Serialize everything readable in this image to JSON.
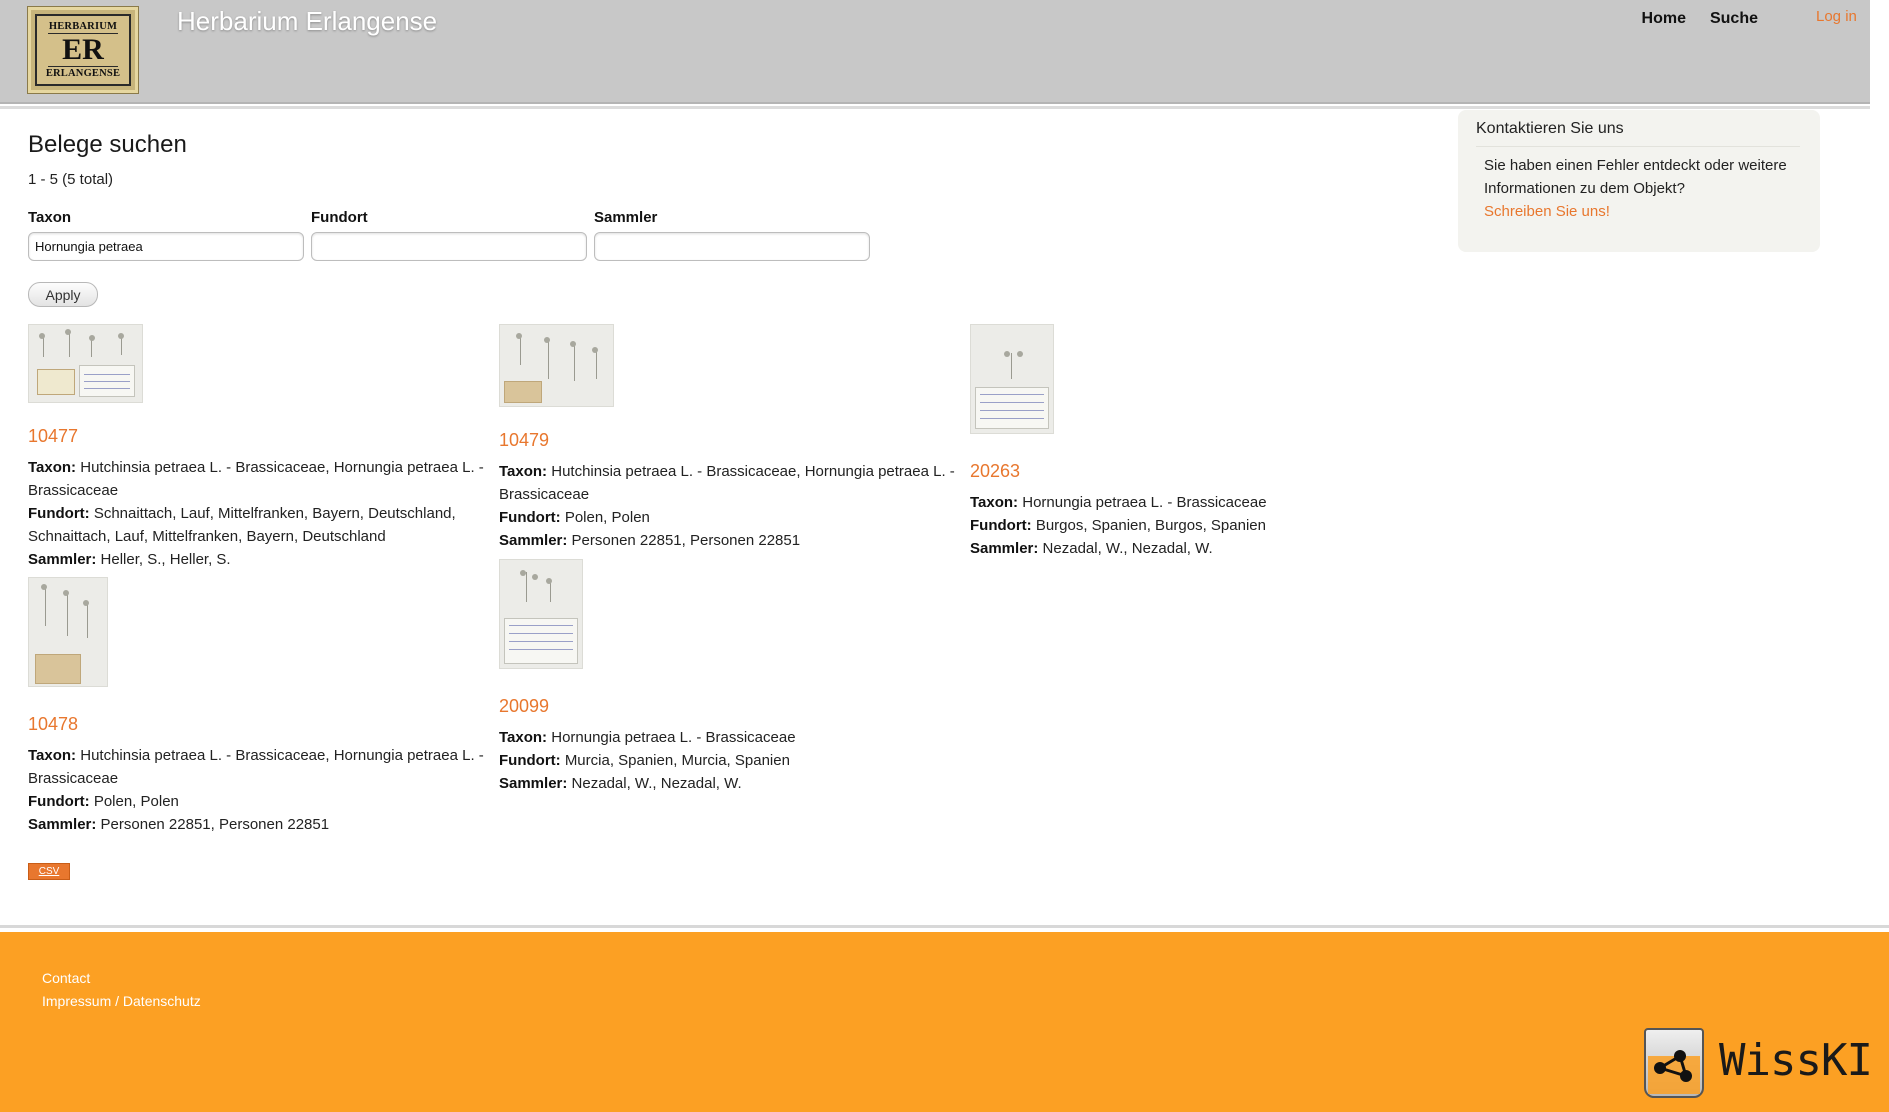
{
  "header": {
    "logo": {
      "line1": "HERBARIUM",
      "line2": "ER",
      "line3": "ERLANGENSE"
    },
    "site_title": "Herbarium Erlangense",
    "nav": [
      {
        "label": "Home"
      },
      {
        "label": "Suche"
      }
    ],
    "login_label": "Log in"
  },
  "search": {
    "title": "Belege suchen",
    "result_count": "1 - 5 (5 total)",
    "filters": {
      "taxon": {
        "label": "Taxon",
        "value": "Hornungia petraea"
      },
      "fundort": {
        "label": "Fundort",
        "value": ""
      },
      "sammler": {
        "label": "Sammler",
        "value": ""
      }
    },
    "apply_label": "Apply",
    "field_labels": {
      "taxon": "Taxon:",
      "fundort": "Fundort:",
      "sammler": "Sammler:"
    }
  },
  "results": [
    {
      "id": "10477",
      "taxon": "Hutchinsia petraea L. - Brassicaceae, Hornungia petraea L. - Brassicaceae",
      "fundort": "Schnaittach, Lauf, Mittelfranken, Bayern, Deutschland, Schnaittach, Lauf, Mittelfranken, Bayern, Deutschland",
      "sammler": "Heller, S., Heller, S."
    },
    {
      "id": "10479",
      "taxon": "Hutchinsia petraea L. - Brassicaceae, Hornungia petraea L. - Brassicaceae",
      "fundort": "Polen, Polen",
      "sammler": "Personen 22851, Personen 22851"
    },
    {
      "id": "20263",
      "taxon": "Hornungia petraea L. - Brassicaceae",
      "fundort": "Burgos, Spanien, Burgos, Spanien",
      "sammler": "Nezadal, W., Nezadal, W."
    },
    {
      "id": "10478",
      "taxon": "Hutchinsia petraea L. - Brassicaceae, Hornungia petraea L. - Brassicaceae",
      "fundort": "Polen, Polen",
      "sammler": "Personen 22851, Personen 22851"
    },
    {
      "id": "20099",
      "taxon": "Hornungia petraea L. - Brassicaceae",
      "fundort": "Murcia, Spanien, Murcia, Spanien",
      "sammler": "Nezadal, W., Nezadal, W."
    }
  ],
  "csv_label": "CSV",
  "sidebar": {
    "contact_title": "Kontaktieren Sie uns",
    "contact_text": "Sie haben einen Fehler entdeckt oder weitere Informationen zu dem Objekt?",
    "contact_link": "Schreiben Sie uns!"
  },
  "footer": {
    "contact": "Contact",
    "impressum": "Impressum / Datenschutz",
    "brand": "WissKI"
  },
  "colors": {
    "accent": "#e8772e",
    "header_bg": "#c8c8c8",
    "footer_bg": "#fca023"
  }
}
